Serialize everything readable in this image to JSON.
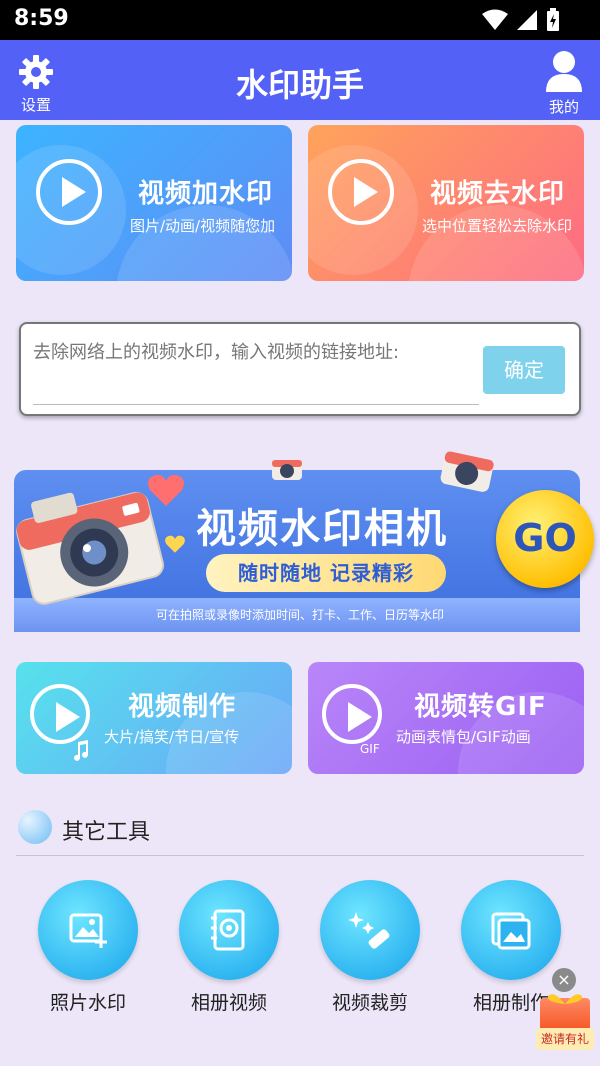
{
  "status_bar": {
    "time": "8:59"
  },
  "app_bar": {
    "title": "水印助手",
    "settings_label": "设置",
    "me_label": "我的"
  },
  "cards": {
    "add_watermark": {
      "title": "视频加水印",
      "subtitle": "图片/动画/视频随您加"
    },
    "remove_watermark": {
      "title": "视频去水印",
      "subtitle": "选中位置轻松去除水印"
    },
    "video_make": {
      "title": "视频制作",
      "subtitle": "大片/搞笑/节日/宣传"
    },
    "video_gif": {
      "title": "视频转GIF",
      "subtitle": "动画表情包/GIF动画",
      "badge": "GIF"
    }
  },
  "link_input": {
    "placeholder": "去除网络上的视频水印，输入视频的链接地址:",
    "confirm_label": "确定"
  },
  "banner": {
    "headline": "视频水印相机",
    "tagline": "随时随地 记录精彩",
    "footnote": "可在拍照或录像时添加时间、打卡、工作、日历等水印",
    "go_label": "GO"
  },
  "other_tools": {
    "title": "其它工具",
    "items": [
      {
        "label": "照片水印",
        "icon": "photo-watermark-icon"
      },
      {
        "label": "相册视频",
        "icon": "album-video-icon"
      },
      {
        "label": "视频裁剪",
        "icon": "video-crop-icon"
      },
      {
        "label": "相册制作",
        "icon": "album-make-icon"
      }
    ]
  },
  "invite": {
    "label": "邀请有礼",
    "close": "×"
  },
  "colors": {
    "app_bar": "#5361f7",
    "background": "#ece6f8",
    "confirm": "#7fd2ec",
    "tool_circle": "#2cb3f0"
  }
}
